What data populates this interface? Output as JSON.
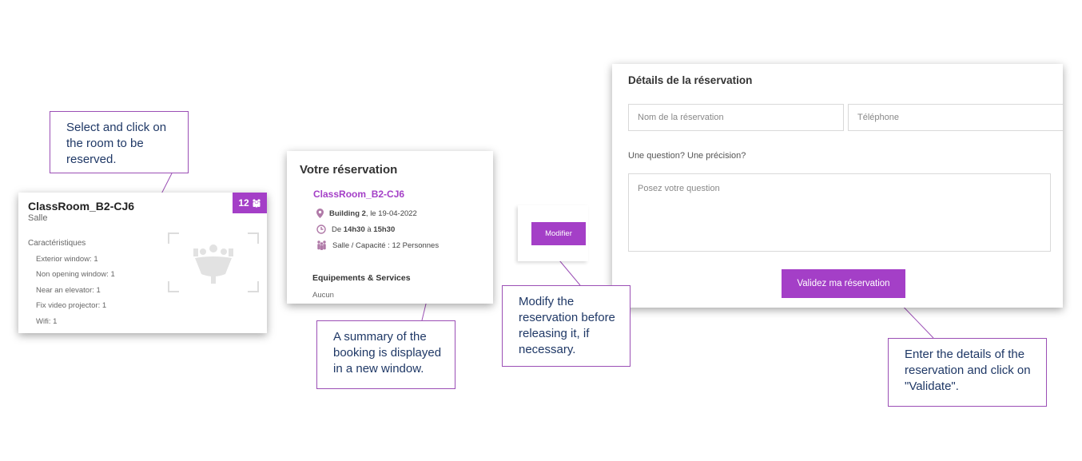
{
  "room_card": {
    "name": "ClassRoom_B2-CJ6",
    "type": "Salle",
    "capacity": "12",
    "features_title": "Caractéristiques",
    "features": [
      "Exterior window: 1",
      "Non opening window: 1",
      "Near an elevator: 1",
      "Fix video projector: 1",
      "Wifi: 1"
    ]
  },
  "summary": {
    "title": "Votre réservation",
    "room": "ClassRoom_B2-CJ6",
    "building": "Building 2",
    "date_text": ", le 19-04-2022",
    "time_prefix": "De ",
    "time_start": "14h30",
    "time_sep": " à ",
    "time_end": "15h30",
    "capacity_text": "Salle / Capacité : 12 Personnes",
    "equipment_title": "Equipements & Services",
    "equipment_value": "Aucun"
  },
  "modify": {
    "label": "Modifier"
  },
  "form": {
    "title": "Détails de la réservation",
    "name_placeholder": "Nom de la réservation",
    "phone_placeholder": "Téléphone",
    "question_label": "Une question? Une précision?",
    "question_placeholder": "Posez votre question",
    "validate_label": "Validez ma réservation"
  },
  "callouts": {
    "select": "Select and click on the room to be reserved.",
    "summary": "A summary of the booking is displayed in a new window.",
    "modify": "Modify the reservation before releasing it, if necessary.",
    "validate": "Enter the details of the reservation and click on \"Validate\"."
  },
  "colors": {
    "accent": "#a43fc7",
    "callout_border": "#9b4fb5",
    "callout_text": "#1f3866"
  }
}
